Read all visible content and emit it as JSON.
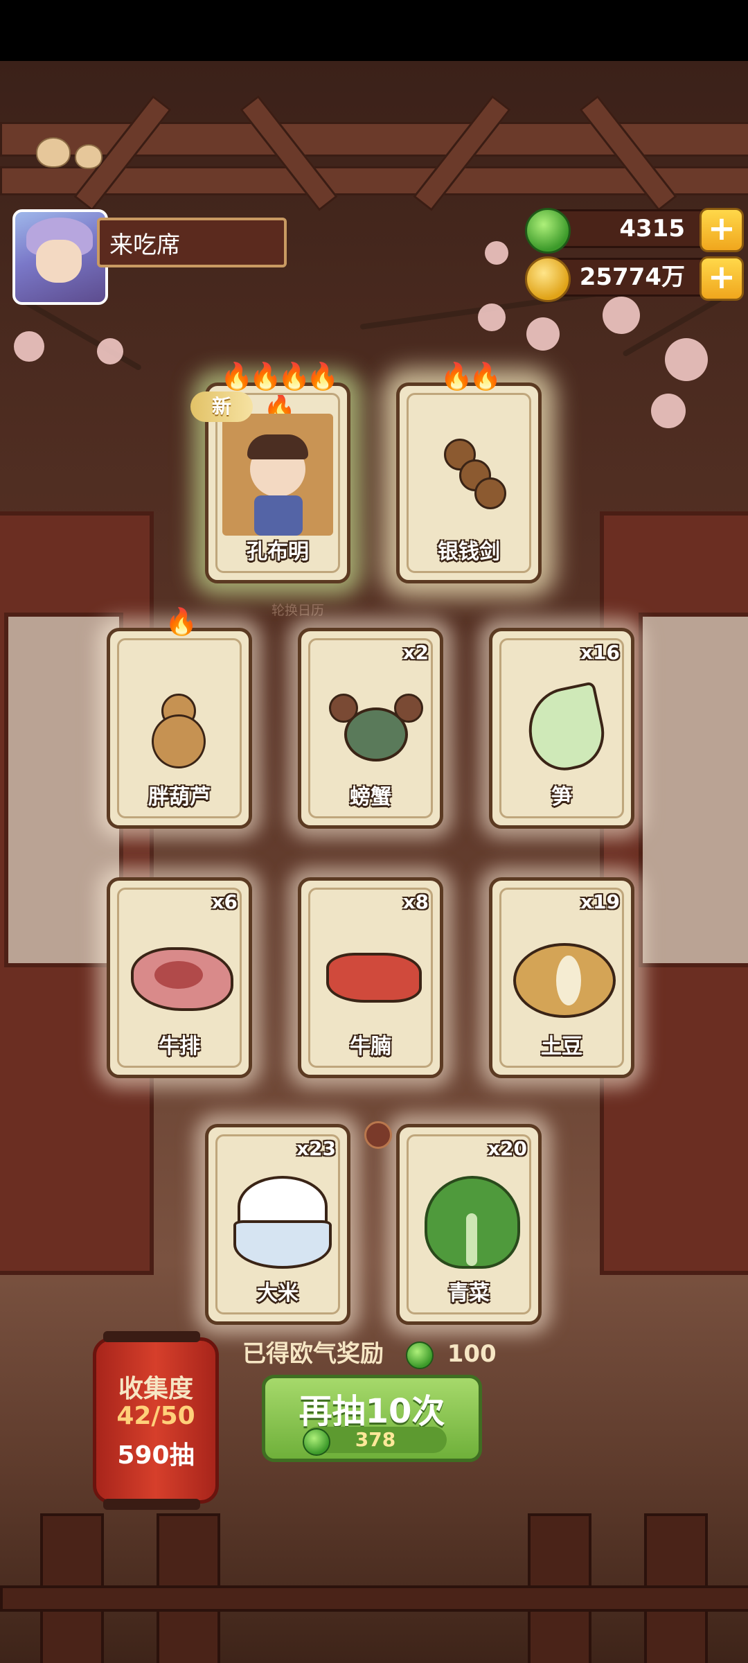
{
  "player": {
    "name": "来吃席"
  },
  "currency": {
    "jade": "4315",
    "coins": "25774万"
  },
  "colors": {
    "accent_green": "#6fb03a",
    "gold": "#f0a61d",
    "card_bg": "#efe4c6",
    "flame": "#e45a1c"
  },
  "featured": [
    {
      "label": "孔布明",
      "flames": "🔥🔥🔥🔥🔥",
      "tag": "新",
      "sublabel": "轮换日历"
    },
    {
      "label": "银钱剑",
      "flames": "🔥🔥"
    }
  ],
  "cards": [
    {
      "label": "胖葫芦",
      "flames": "🔥",
      "count": ""
    },
    {
      "label": "螃蟹",
      "count": "x2"
    },
    {
      "label": "笋",
      "count": "x16"
    },
    {
      "label": "牛排",
      "count": "x6"
    },
    {
      "label": "牛腩",
      "count": "x8"
    },
    {
      "label": "土豆",
      "count": "x19"
    },
    {
      "label": "大米",
      "count": "x23"
    },
    {
      "label": "青菜",
      "count": "x20"
    }
  ],
  "collection": {
    "title": "收集度",
    "progress": "42/50",
    "draws": "590抽"
  },
  "bonus": {
    "text": "已得欧气奖励",
    "amount": "100"
  },
  "draw_button": {
    "label": "再抽10次",
    "cost": "378"
  }
}
